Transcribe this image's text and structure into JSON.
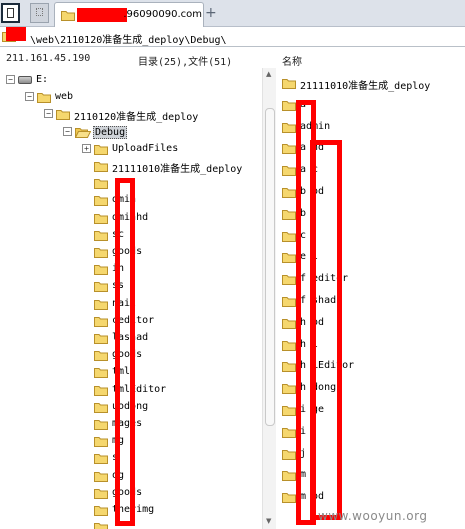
{
  "tabbar": {
    "tab_title": ".96090090.com",
    "new_tab_symbol": "+"
  },
  "pathbar": {
    "path": "\\web\\2110120准备生成_deploy\\Debug\\"
  },
  "status": {
    "server_ip": "211.161.45.190",
    "counts": "目录(25),文件(51)",
    "name_header": "名称"
  },
  "tree": {
    "items": [
      {
        "label": "E:",
        "icon": "drive-icon",
        "toggle": "−"
      },
      {
        "label": "web",
        "icon": "folder-icon",
        "toggle": "−"
      },
      {
        "label": "2110120准备生成_deploy",
        "icon": "folder-icon",
        "toggle": "−"
      },
      {
        "label": "Debug",
        "icon": "folder-open-icon",
        "toggle": "−",
        "selected": true
      },
      {
        "label": "UploadFiles",
        "icon": "folder-icon",
        "toggle": "+"
      },
      {
        "label": "21111010准备生成_deploy",
        "icon": "folder-icon"
      },
      {
        "label": "",
        "icon": "folder-icon"
      },
      {
        "label": "dmin",
        "icon": "folder-icon"
      },
      {
        "label": "dminhd",
        "icon": "folder-icon"
      },
      {
        "label": "sc",
        "icon": "folder-icon"
      },
      {
        "label": "goods",
        "icon": "folder-icon"
      },
      {
        "label": "in",
        "icon": "folder-icon"
      },
      {
        "label": "ss",
        "icon": "folder-icon"
      },
      {
        "label": "nail",
        "icon": "folder-icon"
      },
      {
        "label": "ceditor",
        "icon": "folder-icon"
      },
      {
        "label": "lashad",
        "icon": "folder-icon"
      },
      {
        "label": "goods",
        "icon": "folder-icon"
      },
      {
        "label": "tml",
        "icon": "folder-icon"
      },
      {
        "label": "tmlEditor",
        "icon": "folder-icon"
      },
      {
        "label": "uodong",
        "icon": "folder-icon"
      },
      {
        "label": "mages",
        "icon": "folder-icon"
      },
      {
        "label": "mg",
        "icon": "folder-icon"
      },
      {
        "label": "s",
        "icon": "folder-icon"
      },
      {
        "label": "og",
        "icon": "folder-icon"
      },
      {
        "label": "goods",
        "icon": "folder-icon"
      },
      {
        "label": "therimg",
        "icon": "folder-icon"
      },
      {
        "label": "",
        "icon": "folder-icon"
      }
    ]
  },
  "list": {
    "items": [
      {
        "label": "21111010准备生成_deploy"
      },
      {
        "label": "a"
      },
      {
        "label": "admin"
      },
      {
        "label": "a   hd"
      },
      {
        "label": "a  c"
      },
      {
        "label": "b   od"
      },
      {
        "label": "b"
      },
      {
        "label": "c"
      },
      {
        "label": "e  l"
      },
      {
        "label": "f  editor"
      },
      {
        "label": "f   shad"
      },
      {
        "label": "h   od"
      },
      {
        "label": "h   l"
      },
      {
        "label": "h   LEditor"
      },
      {
        "label": "h   dong"
      },
      {
        "label": "i   ge"
      },
      {
        "label": "i"
      },
      {
        "label": "j"
      },
      {
        "label": "m"
      },
      {
        "label": "m   od"
      }
    ]
  },
  "watermark": "www.wooyun.org",
  "colors": {
    "redaction": "#ff0000",
    "folder_fill": "#f5d76e",
    "folder_stroke": "#b8902a",
    "tabbar_bg": "#dde2ea"
  }
}
